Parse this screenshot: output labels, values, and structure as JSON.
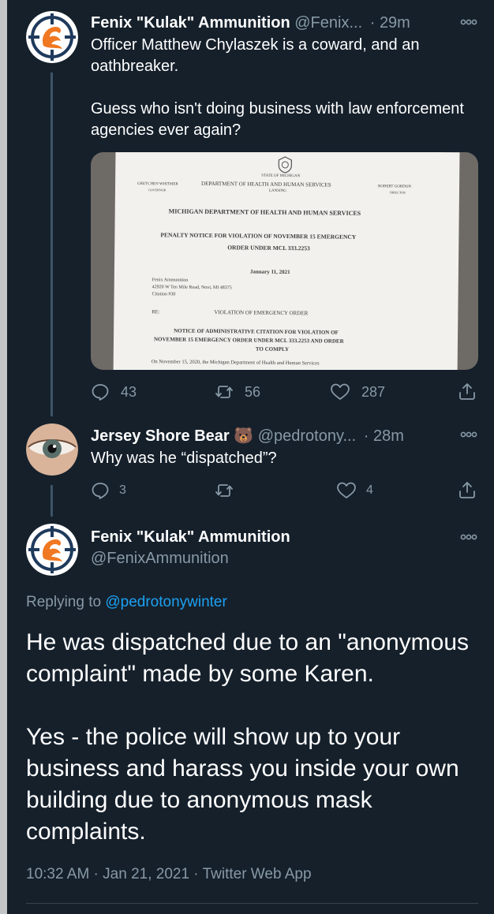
{
  "tweet1": {
    "display_name": "Fenix \"Kulak\" Ammunition",
    "handle": "@Fenix...",
    "separator": "·",
    "time": "29m",
    "text": "Officer Matthew Chylaszek is a coward, and an oathbreaker.\n\nGuess who isn't doing business with law enforcement agencies ever again?",
    "reply_count": "43",
    "retweet_count": "56",
    "like_count": "287"
  },
  "document": {
    "state": "STATE OF MICHIGAN",
    "department": "DEPARTMENT OF HEALTH AND HUMAN SERVICES",
    "city": "LANSING",
    "left_name": "GRETCHEN WHITMER",
    "left_title": "GOVERNOR",
    "right_name": "ROBERT GORDON",
    "right_title": "DIRECTOR",
    "heading": "MICHIGAN DEPARTMENT OF HEALTH AND HUMAN SERVICES",
    "notice_line1": "PENALTY NOTICE FOR VIOLATION OF NOVEMBER 15 EMERGENCY",
    "notice_line2": "ORDER UNDER MCL 333.2253",
    "date": "January 11, 2021",
    "addr1": "Fenix Ammunition",
    "addr2": "42920 W Ten Mile Road, Novi, MI 48375",
    "addr3": "Citation #30",
    "re_label": "RE:",
    "re_value": "VIOLATION OF EMERGENCY ORDER",
    "citation1": "NOTICE OF ADMINISTRATIVE CITATION FOR VIOLATION OF",
    "citation2": "NOVEMBER 15 EMERGENCY ORDER UNDER MCL 333.2253 AND ORDER",
    "citation3": "TO COMPLY",
    "body1": "On November 15, 2020, the Michigan Department of Health and Human Services"
  },
  "tweet2": {
    "display_name": "Jersey Shore Bear",
    "emoji": "🐻",
    "handle": "@pedrotony...",
    "separator": "·",
    "time": "28m",
    "text": "Why was he “dispatched”?",
    "reply_count": "3",
    "like_count": "4"
  },
  "tweet3": {
    "display_name": "Fenix \"Kulak\" Ammunition",
    "handle": "@FenixAmmunition",
    "replying_prefix": "Replying to",
    "replying_to": "@pedrotonywinter",
    "text": "He was dispatched due to an \"anonymous complaint\" made by some Karen.\n\nYes - the police will show up to your business and harass you inside your own building due to anonymous mask complaints.",
    "timestamp": "10:32 AM · Jan 21, 2021 · Twitter Web App"
  },
  "colors": {
    "background": "#15202b",
    "muted": "#8899a6",
    "link": "#1da1f2",
    "avatar_orange": "#f07822",
    "avatar_navy": "#1f3a5c"
  }
}
